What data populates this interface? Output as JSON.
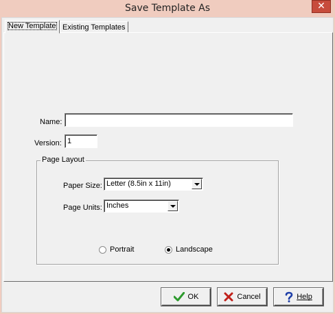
{
  "window": {
    "title": "Save Template As",
    "close_glyph": "✕"
  },
  "tabs": [
    {
      "label": "New Template",
      "active": true
    },
    {
      "label": "Existing Templates",
      "active": false
    }
  ],
  "form": {
    "name_label": "Name:",
    "name_value": "",
    "version_label": "Version:",
    "version_value": "1",
    "page_layout": {
      "title": "Page Layout",
      "paper_size_label": "Paper Size:",
      "paper_size_value": "Letter (8.5in x 11in)",
      "page_units_label": "Page Units:",
      "page_units_value": "Inches",
      "orientation": {
        "portrait_label": "Portrait",
        "landscape_label": "Landscape",
        "selected": "landscape"
      }
    }
  },
  "buttons": {
    "ok": {
      "label": "OK",
      "icon": "check-icon"
    },
    "cancel": {
      "label": "Cancel",
      "icon": "x-icon"
    },
    "help": {
      "label": "Help",
      "icon": "question-icon"
    }
  },
  "colors": {
    "title_bar": "#f0ccbf",
    "close_button": "#c74c3c",
    "ok_check": "#2e9a2e",
    "cancel_x": "#c0201a",
    "help_q": "#1f3fa8"
  }
}
